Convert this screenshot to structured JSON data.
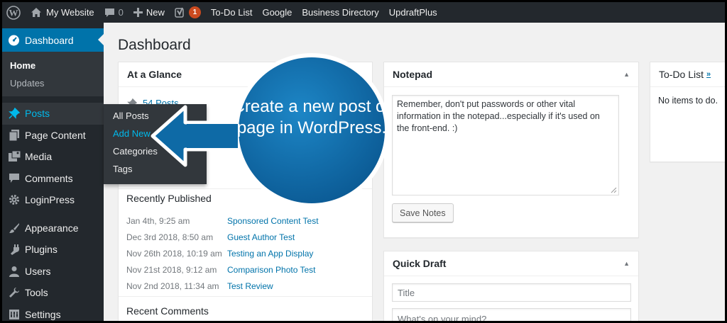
{
  "adminbar": {
    "site_name": "My Website",
    "comments_count": "0",
    "new_label": "New",
    "updates_count": "1",
    "links": [
      "To-Do List",
      "Google",
      "Business Directory",
      "UpdraftPlus"
    ]
  },
  "sidebar": {
    "dashboard_label": "Dashboard",
    "dashboard_sub": [
      "Home",
      "Updates"
    ],
    "items": [
      {
        "label": "Posts",
        "icon": "pin-icon"
      },
      {
        "label": "Page Content",
        "icon": "pages-icon"
      },
      {
        "label": "Media",
        "icon": "media-icon"
      },
      {
        "label": "Comments",
        "icon": "comment-icon"
      },
      {
        "label": "LoginPress",
        "icon": "gear-icon"
      },
      {
        "label": "Appearance",
        "icon": "brush-icon"
      },
      {
        "label": "Plugins",
        "icon": "plug-icon"
      },
      {
        "label": "Users",
        "icon": "user-icon"
      },
      {
        "label": "Tools",
        "icon": "wrench-icon"
      },
      {
        "label": "Settings",
        "icon": "settings-icon"
      }
    ]
  },
  "flyout": {
    "items": [
      "All Posts",
      "Add New",
      "Categories",
      "Tags"
    ],
    "active": "Add New"
  },
  "page": {
    "title": "Dashboard"
  },
  "glance": {
    "title": "At a Glance",
    "posts_link": "54 Posts"
  },
  "activity": {
    "recently_published": "Recently Published",
    "rows": [
      {
        "date": "Jan 4th, 9:25 am",
        "title": "Sponsored Content Test"
      },
      {
        "date": "Dec 3rd 2018, 8:50 am",
        "title": "Guest Author Test"
      },
      {
        "date": "Nov 26th 2018, 10:19 am",
        "title": "Testing an App Display"
      },
      {
        "date": "Nov 21st 2018, 9:12 am",
        "title": "Comparison Photo Test"
      },
      {
        "date": "Nov 2nd 2018, 11:34 am",
        "title": "Test Review"
      }
    ],
    "recent_comments": "Recent Comments"
  },
  "notepad": {
    "title": "Notepad",
    "text": "Remember, don't put passwords or other vital information in the notepad...especially if it's used on the front-end. :)",
    "save_label": "Save Notes"
  },
  "quick_draft": {
    "title": "Quick Draft",
    "title_placeholder": "Title",
    "content_placeholder": "What's on your mind?"
  },
  "todo": {
    "title": "To-Do List",
    "title_suffix": "»",
    "empty": "No items to do."
  },
  "callout": {
    "text": "Create a new post or page in WordPress.",
    "color": "#0e6aa6"
  }
}
